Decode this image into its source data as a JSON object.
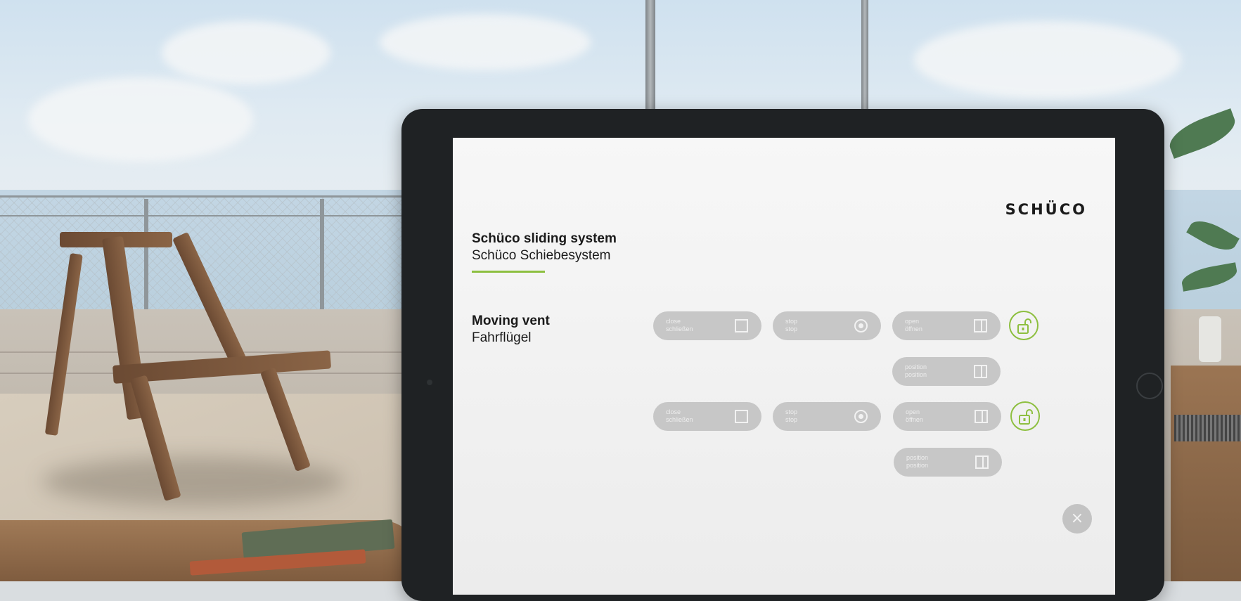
{
  "app": {
    "brand_logo": "SCHÜCO",
    "title_en": "Schüco sliding system",
    "title_de": "Schüco Schiebesystem",
    "section_en": "Moving vent",
    "section_de": "Fahrflügel",
    "accent_color": "#8dbf3f"
  },
  "vents": [
    {
      "close": {
        "en": "close",
        "de": "schließen",
        "icon": "square-icon"
      },
      "stop": {
        "en": "stop",
        "de": "stop",
        "icon": "stop-circle-icon"
      },
      "open": {
        "en": "open",
        "de": "öffnen",
        "icon": "open-panel-icon"
      },
      "position": {
        "en": "position",
        "de": "position",
        "icon": "position-panel-icon"
      },
      "lock_icon": "unlocked-padlock-icon"
    },
    {
      "close": {
        "en": "close",
        "de": "schließen",
        "icon": "square-icon"
      },
      "stop": {
        "en": "stop",
        "de": "stop",
        "icon": "stop-circle-icon"
      },
      "open": {
        "en": "open",
        "de": "öffnen",
        "icon": "open-panel-icon"
      },
      "position": {
        "en": "position",
        "de": "position",
        "icon": "position-panel-icon"
      },
      "lock_icon": "unlocked-padlock-icon"
    }
  ],
  "close_button": {
    "symbol": "×"
  }
}
